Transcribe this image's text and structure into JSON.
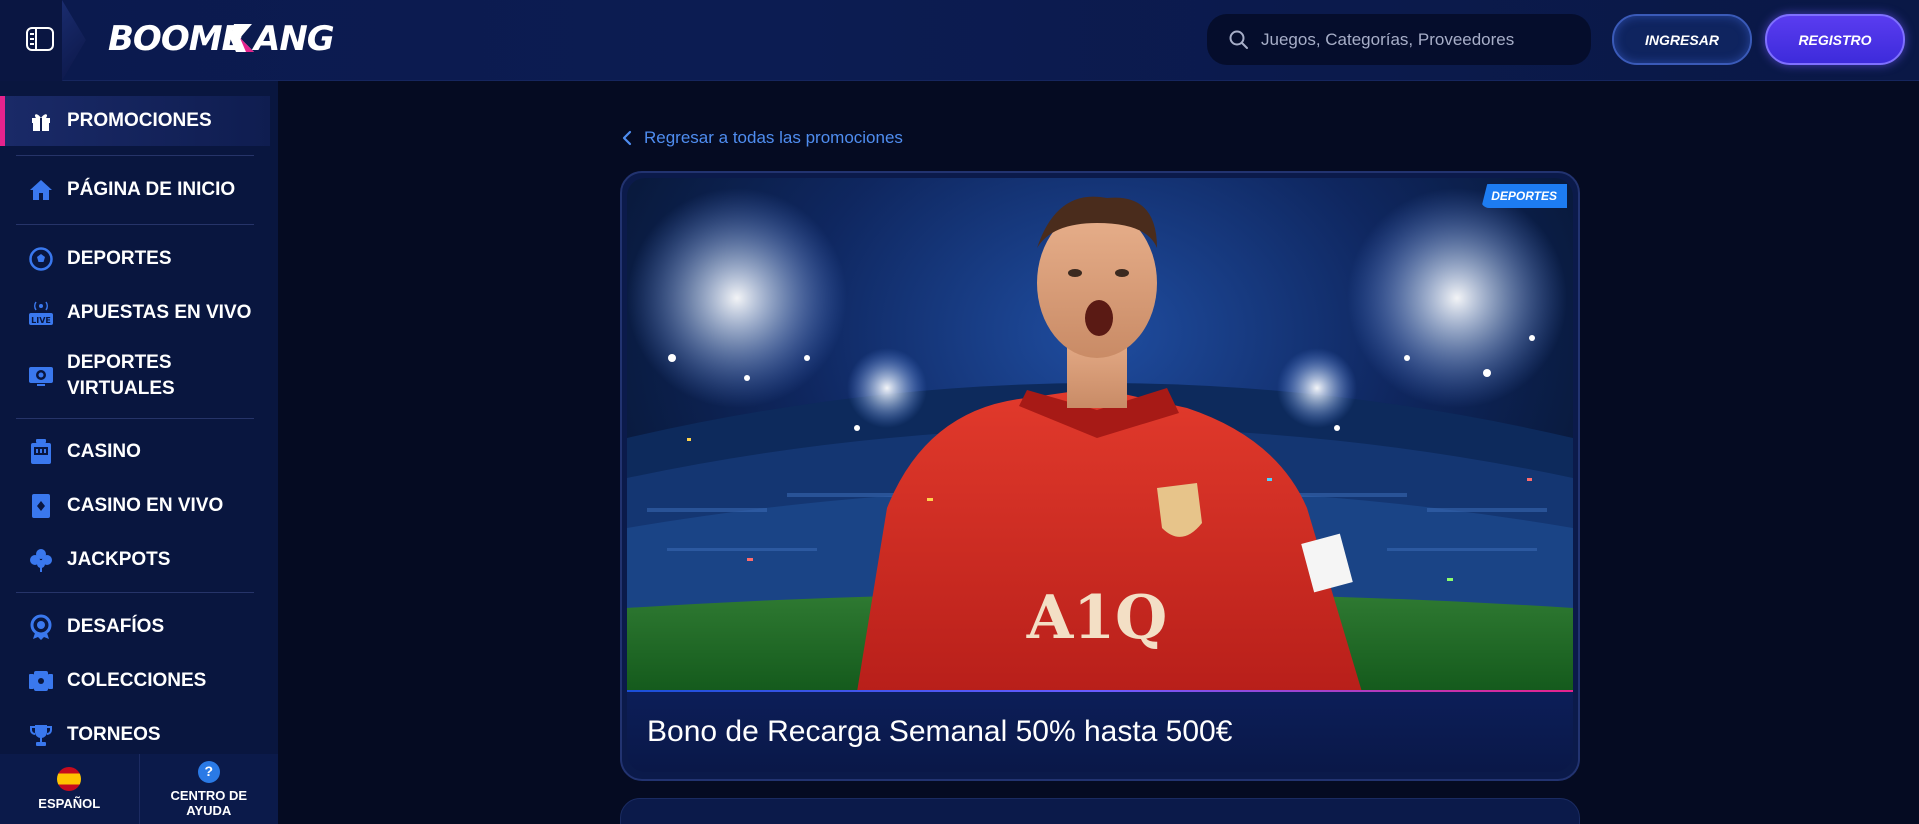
{
  "header": {
    "logo": "BOOMERANG",
    "search_placeholder": "Juegos, Categorías, Proveedores",
    "login_label": "INGRESAR",
    "register_label": "REGISTRO"
  },
  "sidebar": {
    "items": [
      {
        "label": "PROMOCIONES",
        "icon": "gift-icon",
        "active": true
      },
      {
        "label": "PÁGINA DE INICIO",
        "icon": "home-icon"
      },
      {
        "label": "DEPORTES",
        "icon": "soccer-ball-icon"
      },
      {
        "label": "APUESTAS EN VIVO",
        "icon": "live-broadcast-icon"
      },
      {
        "label": "DEPORTES VIRTUALES",
        "icon": "virtual-sports-icon"
      },
      {
        "label": "CASINO",
        "icon": "slot-machine-icon"
      },
      {
        "label": "CASINO EN VIVO",
        "icon": "cards-icon"
      },
      {
        "label": "JACKPOTS",
        "icon": "clover-icon"
      },
      {
        "label": "DESAFÍOS",
        "icon": "medal-icon"
      },
      {
        "label": "COLECCIONES",
        "icon": "collection-icon"
      },
      {
        "label": "TORNEOS",
        "icon": "trophy-icon"
      }
    ],
    "footer": {
      "language_label": "ESPAÑOL",
      "help_label": "CENTRO DE AYUDA"
    }
  },
  "main": {
    "back_link": "Regresar a todas las promociones",
    "promo": {
      "badge": "DEPORTES",
      "title": "Bono de Recarga Semanal 50% hasta 500€",
      "jersey_text": "A1Q"
    }
  },
  "colors": {
    "accent_pink": "#e5238d",
    "accent_blue": "#1d7cf2",
    "register_purple": "#4f35ea",
    "background": "#050b22"
  }
}
